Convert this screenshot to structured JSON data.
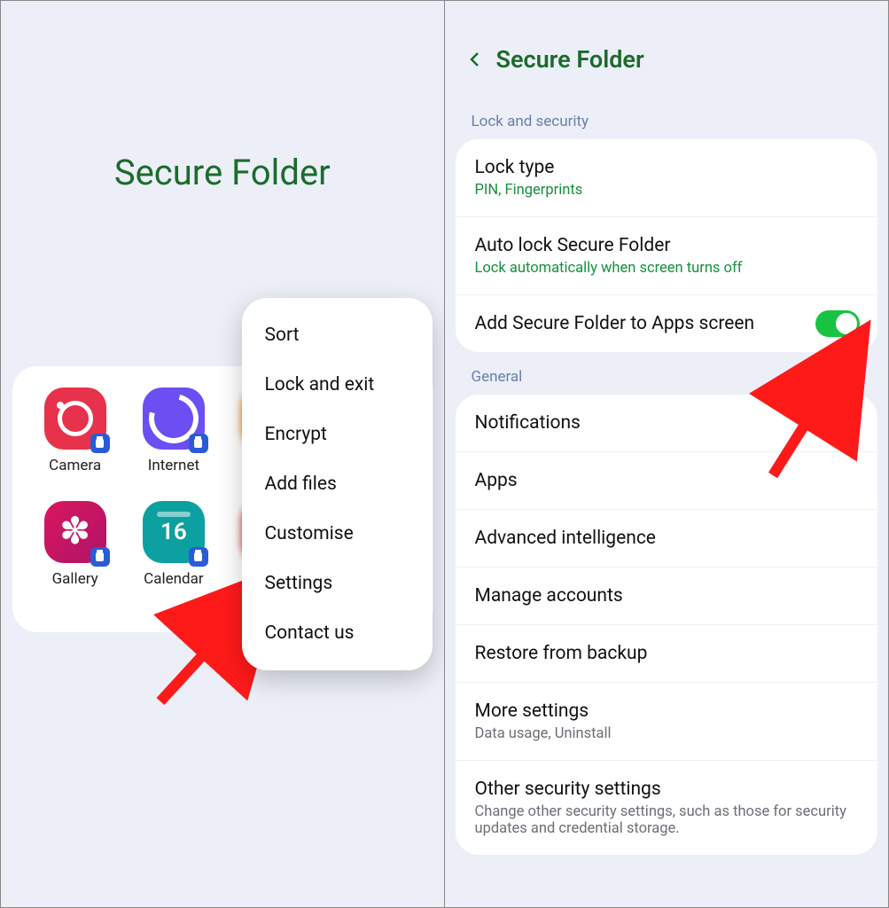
{
  "left": {
    "title": "Secure Folder",
    "apps": [
      {
        "id": "camera",
        "label": "Camera"
      },
      {
        "id": "internet",
        "label": "Internet"
      },
      {
        "id": "gallery",
        "label": "Gallery"
      },
      {
        "id": "calendar",
        "label": "Calendar"
      }
    ],
    "menu": [
      "Sort",
      "Lock and exit",
      "Encrypt",
      "Add files",
      "Customise",
      "Settings",
      "Contact us"
    ]
  },
  "right": {
    "title": "Secure Folder",
    "sections": {
      "lock": {
        "label": "Lock and security",
        "items": [
          {
            "title": "Lock type",
            "sub": "PIN, Fingerprints"
          },
          {
            "title": "Auto lock Secure Folder",
            "sub": "Lock automatically when screen turns off"
          },
          {
            "title": "Add Secure Folder to Apps screen",
            "toggle": true
          }
        ]
      },
      "general": {
        "label": "General",
        "items": [
          {
            "title": "Notifications"
          },
          {
            "title": "Apps"
          },
          {
            "title": "Advanced intelligence"
          },
          {
            "title": "Manage accounts"
          },
          {
            "title": "Restore from backup"
          },
          {
            "title": "More settings",
            "sub": "Data usage, Uninstall",
            "grey": true
          },
          {
            "title": "Other security settings",
            "sub": "Change other security settings, such as those for security updates and credential storage.",
            "grey": true
          }
        ]
      }
    }
  }
}
